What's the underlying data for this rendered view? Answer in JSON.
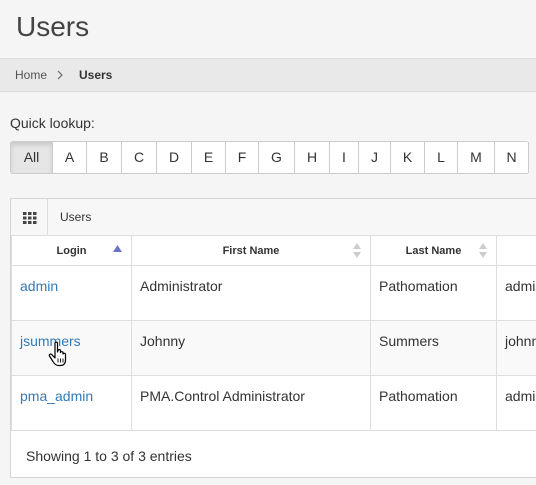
{
  "page": {
    "title": "Users"
  },
  "breadcrumb": {
    "home": "Home",
    "current": "Users"
  },
  "quick_lookup": {
    "label": "Quick lookup:",
    "letters": [
      "All",
      "A",
      "B",
      "C",
      "D",
      "E",
      "F",
      "G",
      "H",
      "I",
      "J",
      "K",
      "L",
      "M",
      "N"
    ],
    "active": "All"
  },
  "panel": {
    "title": "Users",
    "icon": "grid-icon"
  },
  "table": {
    "columns": [
      "Login",
      "First Name",
      "Last Name",
      ""
    ],
    "rows": [
      [
        "admin",
        "Administrator",
        "Pathomation",
        "admi"
      ],
      [
        "jsummers",
        "Johnny",
        "Summers",
        "johnn"
      ],
      [
        "pma_admin",
        "PMA.Control Administrator",
        "Pathomation",
        "admi"
      ]
    ]
  },
  "footer": {
    "info": "Showing 1 to 3 of 3 entries"
  },
  "colors": {
    "link": "#337ab7",
    "accent_sort": "#6a74c9"
  }
}
